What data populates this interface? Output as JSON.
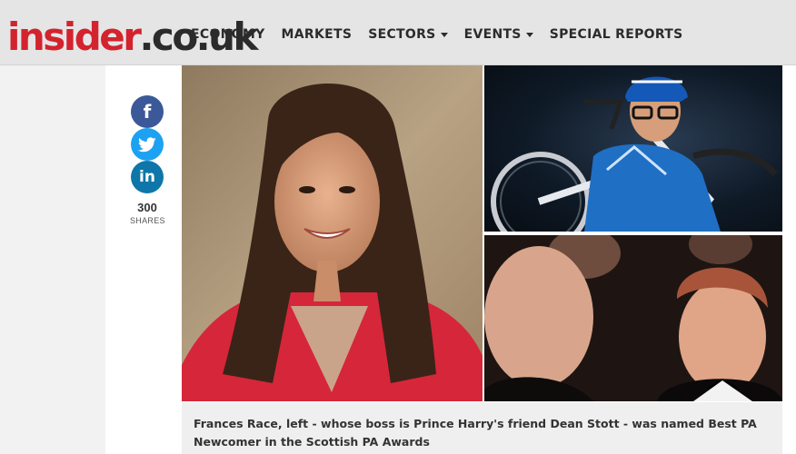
{
  "header": {
    "logo_part1": "insider",
    "logo_part2": ".co.uk",
    "nav": [
      {
        "label": "ECONOMY",
        "has_dropdown": false
      },
      {
        "label": "MARKETS",
        "has_dropdown": false
      },
      {
        "label": "SECTORS",
        "has_dropdown": true
      },
      {
        "label": "EVENTS",
        "has_dropdown": true
      },
      {
        "label": "SPECIAL REPORTS",
        "has_dropdown": false
      }
    ]
  },
  "share": {
    "facebook_icon": "f",
    "twitter_icon": "twitter-bird-icon",
    "linkedin_icon": "in",
    "count": "300",
    "label": "SHARES"
  },
  "article": {
    "caption": "Frances Race, left - whose boss is Prince Harry's friend Dean Stott - was named Best PA Newcomer in the Scottish PA Awards"
  },
  "colors": {
    "brand_red": "#d3232e",
    "facebook": "#3b5998",
    "twitter": "#1da1f2",
    "linkedin": "#0e76a8"
  }
}
